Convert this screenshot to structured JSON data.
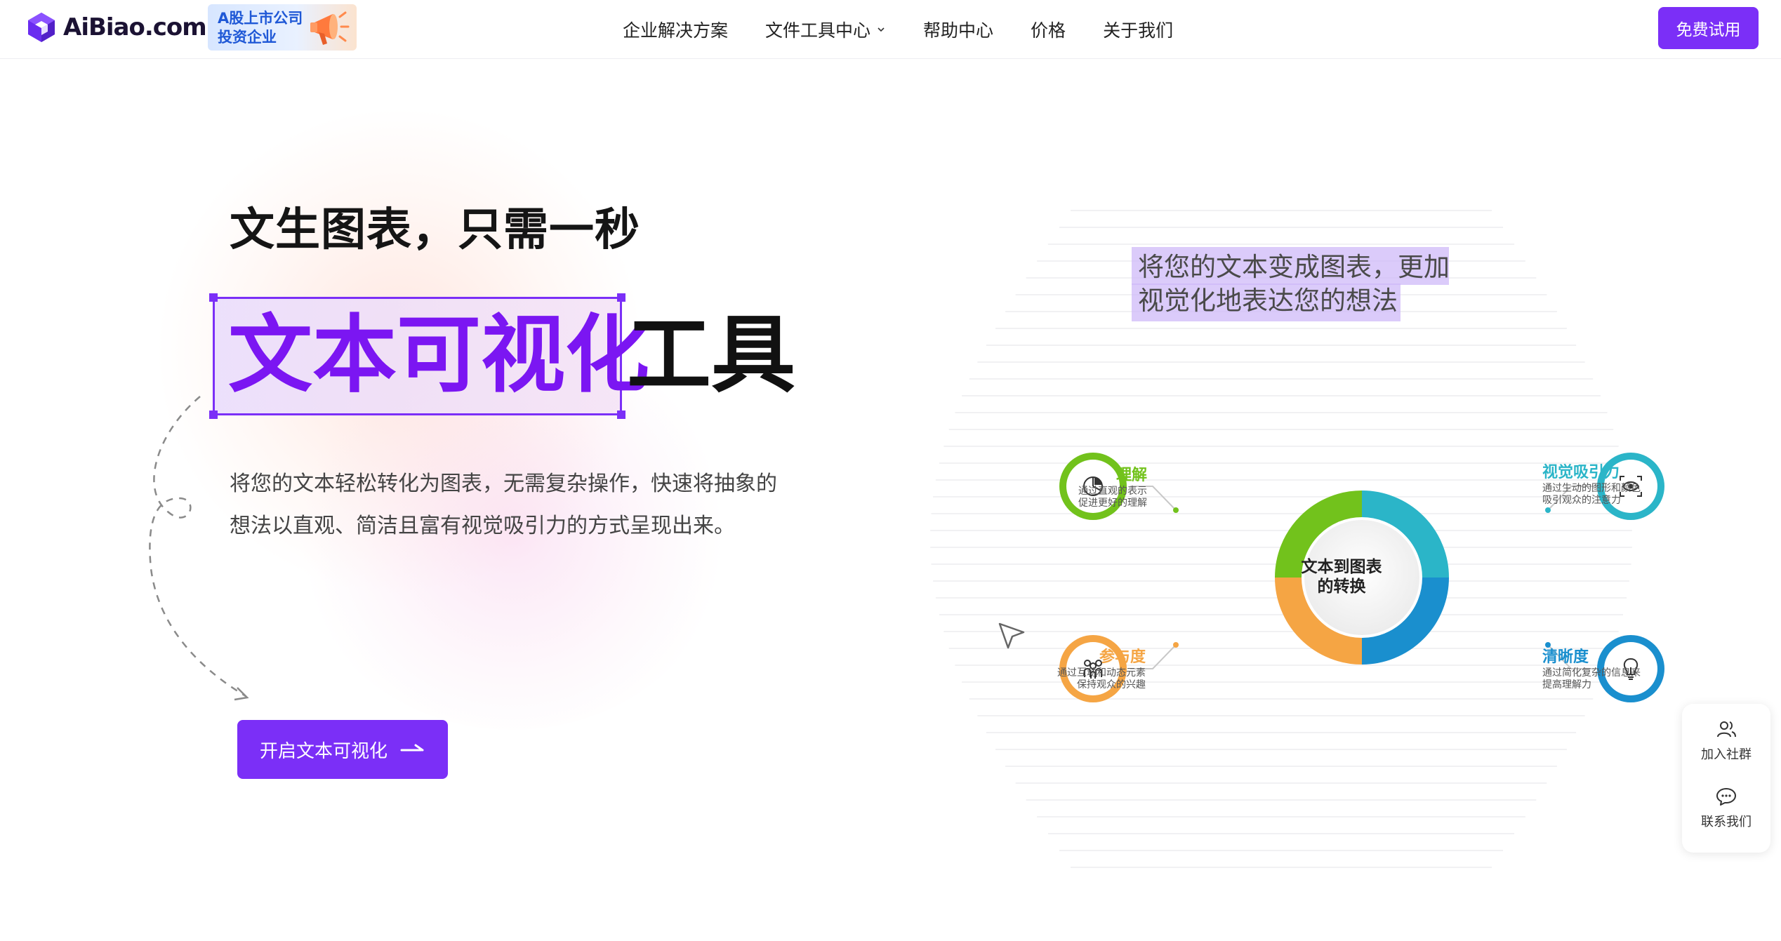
{
  "header": {
    "logo_text": "AiBiao.com",
    "badge_line1": "A股上市公司",
    "badge_line2": "投资企业",
    "nav": [
      {
        "label": "企业解决方案",
        "has_dropdown": false
      },
      {
        "label": "文件工具中心",
        "has_dropdown": true
      },
      {
        "label": "帮助中心",
        "has_dropdown": false
      },
      {
        "label": "价格",
        "has_dropdown": false
      },
      {
        "label": "关于我们",
        "has_dropdown": false
      }
    ],
    "cta_label": "免费试用"
  },
  "hero": {
    "subtitle": "文生图表，只需一秒",
    "highlight": "文本可视化",
    "title_tail": "工具",
    "description": "将您的文本轻松转化为图表，无需复杂操作，快速将抽象的想法以直观、简洁且富有视觉吸引力的方式呈现出来。",
    "cta_label": "开启文本可视化"
  },
  "illustration": {
    "tag_line1": "将您的文本变成图表，更加",
    "tag_line2": "视觉化地表达您的想法",
    "center_line1": "文本到图表",
    "center_line2": "的转换",
    "nodes": [
      {
        "title": "理解",
        "desc_line1": "通过直观的表示",
        "desc_line2": "促进更好的理解",
        "color": "#72c21c",
        "icon": "pie-chart-icon"
      },
      {
        "title": "视觉吸引力",
        "desc_line1": "通过生动的图形和颜色",
        "desc_line2": "吸引观众的注意力",
        "color": "#2bb5c8",
        "icon": "eye-scan-icon"
      },
      {
        "title": "参与度",
        "desc_line1": "通过互动和动态元素",
        "desc_line2": "保持观众的兴趣",
        "color": "#f5a544",
        "icon": "people-icon"
      },
      {
        "title": "清晰度",
        "desc_line1": "通过简化复杂的信息来",
        "desc_line2": "提高理解力",
        "color": "#1a8fce",
        "icon": "lightbulb-icon"
      }
    ]
  },
  "side_widget": {
    "join_label": "加入社群",
    "contact_label": "联系我们"
  },
  "colors": {
    "brand": "#7b2ff7",
    "highlight_text": "#7b16f2"
  }
}
